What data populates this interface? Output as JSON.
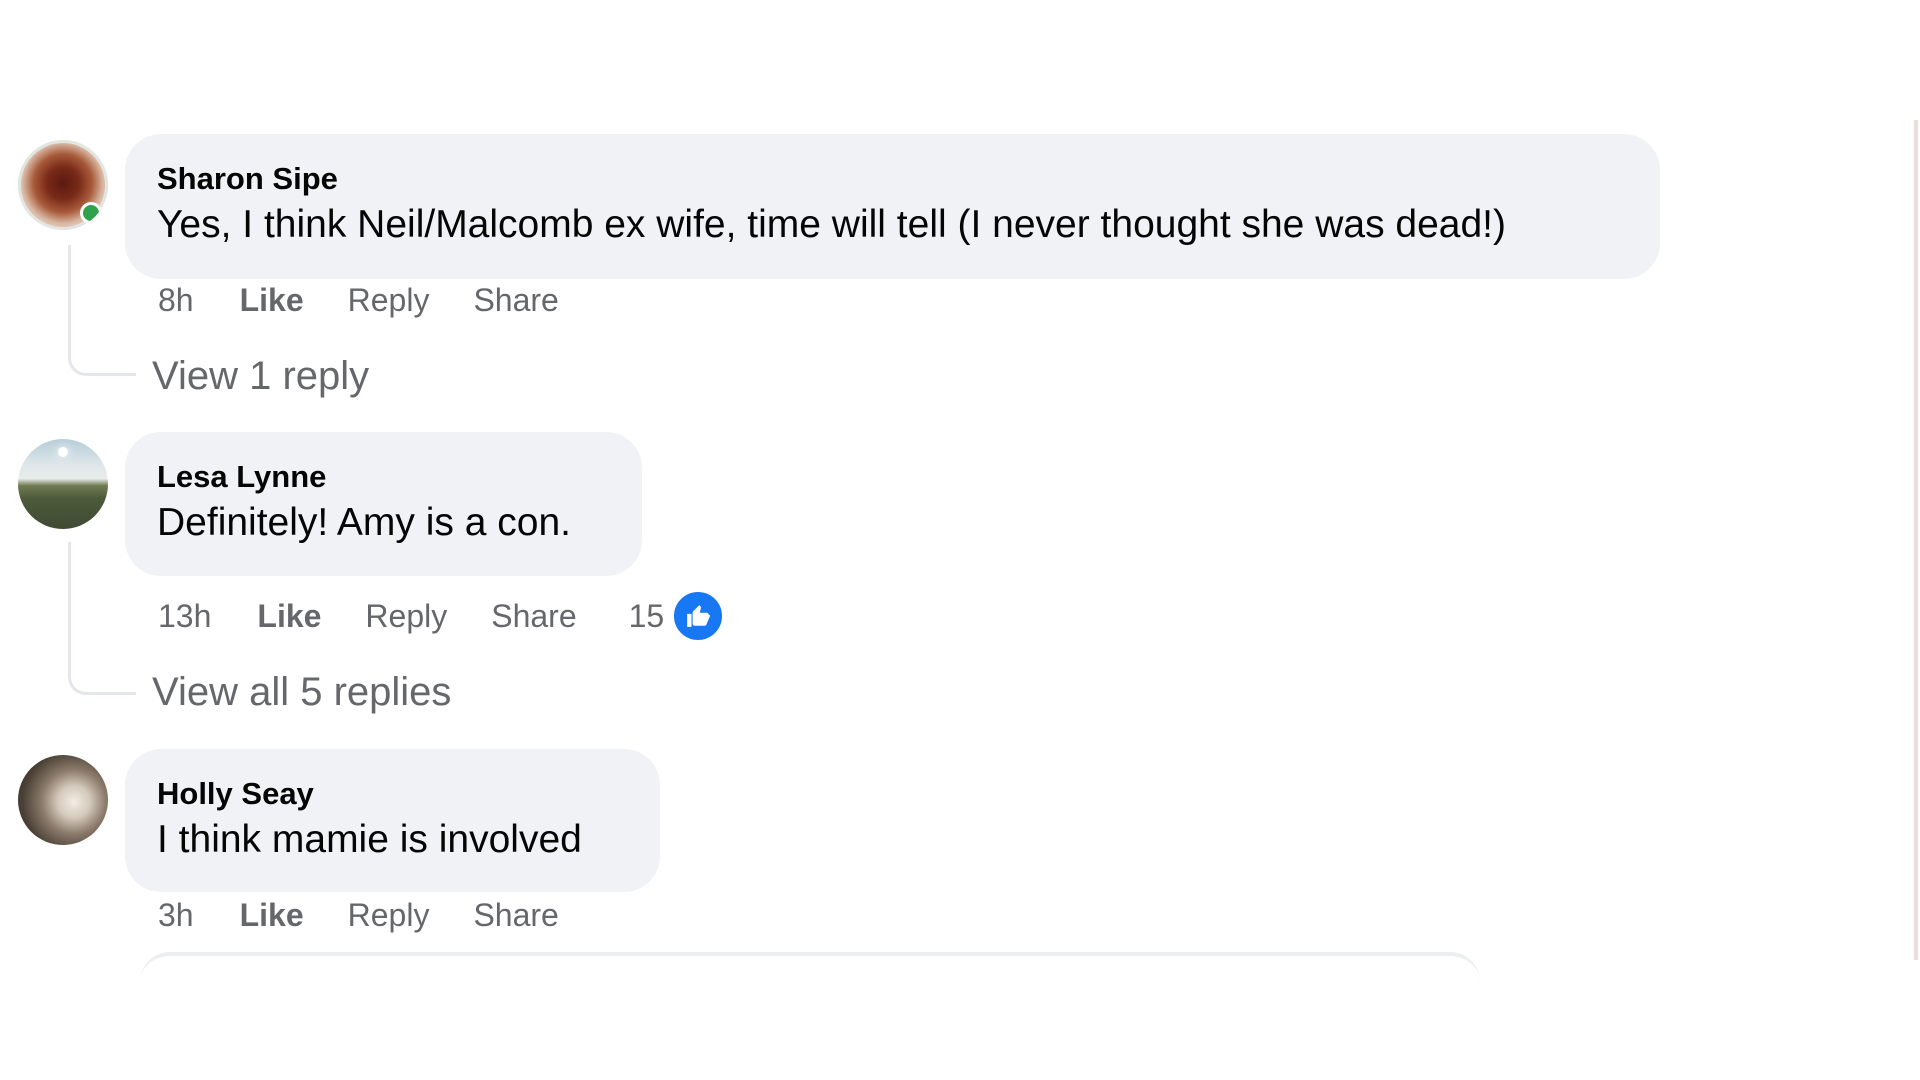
{
  "comments": [
    {
      "author": "Sharon Sipe",
      "text": "Yes, I think Neil/Malcomb ex wife, time will tell (I never thought she was dead!)",
      "time": "8h",
      "like_label": "Like",
      "reply_label": "Reply",
      "share_label": "Share",
      "view_replies": "View 1 reply",
      "online": true
    },
    {
      "author": "Lesa Lynne",
      "text": "Definitely! Amy is a con.",
      "time": "13h",
      "like_label": "Like",
      "reply_label": "Reply",
      "share_label": "Share",
      "reaction_count": "15",
      "reaction_icon": "thumbs-up-icon",
      "view_replies": "View all 5 replies"
    },
    {
      "author": "Holly Seay",
      "text": "I think mamie is involved",
      "time": "3h",
      "like_label": "Like",
      "reply_label": "Reply",
      "share_label": "Share"
    }
  ],
  "colors": {
    "bubble_bg": "#f0f2f5",
    "secondary_text": "#65676b",
    "primary_text": "#050505",
    "like_blue": "#1877f2",
    "online_green": "#31a24c"
  }
}
